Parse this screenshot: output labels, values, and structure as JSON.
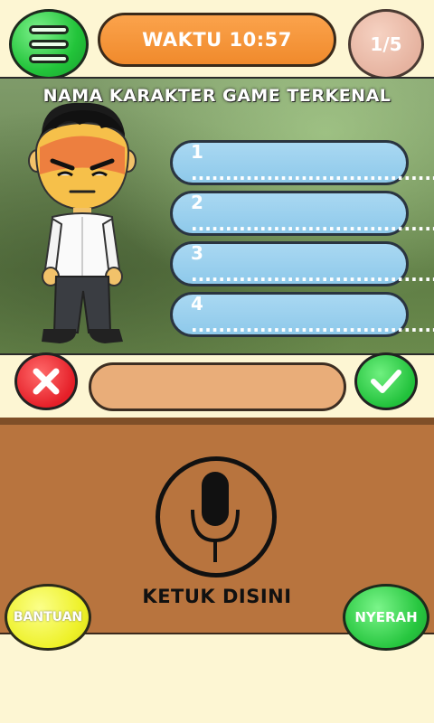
{
  "header": {
    "timer_text": "WAKTU 10:57",
    "progress_text": "1/5"
  },
  "question": {
    "category": "NAMA KARAKTER GAME TERKENAL",
    "slots": [
      {
        "label": "1 ...................................."
      },
      {
        "label": "2 ...................................."
      },
      {
        "label": "3 ...................................."
      },
      {
        "label": "4 ...................................."
      }
    ]
  },
  "input": {
    "value": ""
  },
  "panel": {
    "tap_label": "KETUK DISINI",
    "help_label": "BANTUAN",
    "giveup_label": "NYERAH"
  },
  "colors": {
    "timer": "#f08a2c",
    "slot": "#8ec9ea",
    "panel": "#b8743e",
    "wrong": "#e51f28",
    "correct": "#21c13b",
    "help": "#eef12a"
  }
}
